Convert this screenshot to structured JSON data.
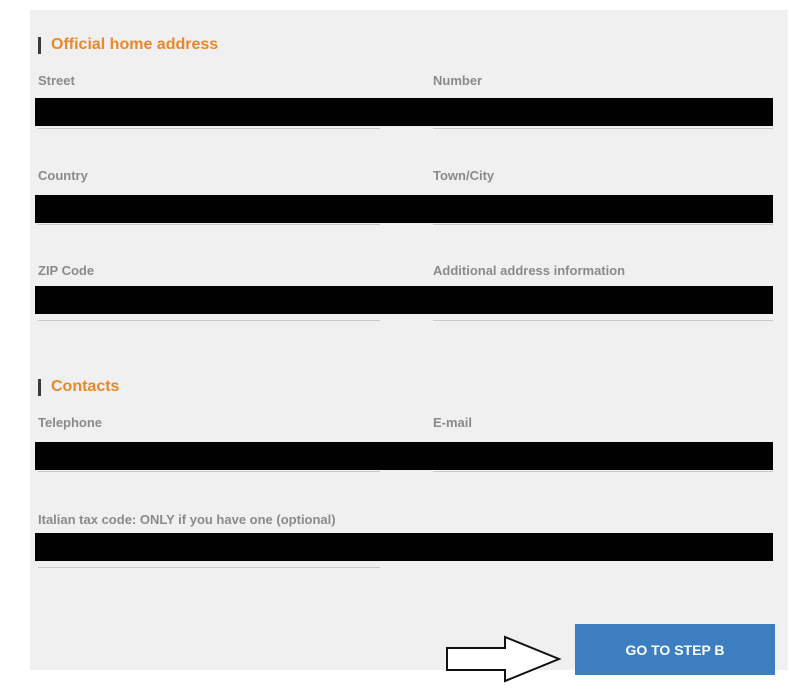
{
  "sections": {
    "address": {
      "title": "Official home address"
    },
    "contacts": {
      "title": "Contacts"
    }
  },
  "fields": {
    "street": "Street",
    "number": "Number",
    "country": "Country",
    "town_city": "Town/City",
    "zip_code": "ZIP Code",
    "additional_info": "Additional address information",
    "telephone": "Telephone",
    "email": "E-mail",
    "tax_code": "Italian tax code: ONLY if you have one (optional)"
  },
  "actions": {
    "next_label": "GO TO STEP B"
  },
  "colors": {
    "section_title": "#e8882a",
    "button_bg": "#3d7ec1",
    "label": "#8a8a8a",
    "panel_bg": "#f0f0f0",
    "redaction": "#000000"
  },
  "icons": {
    "pointer_arrow": "right-arrow-outline"
  }
}
